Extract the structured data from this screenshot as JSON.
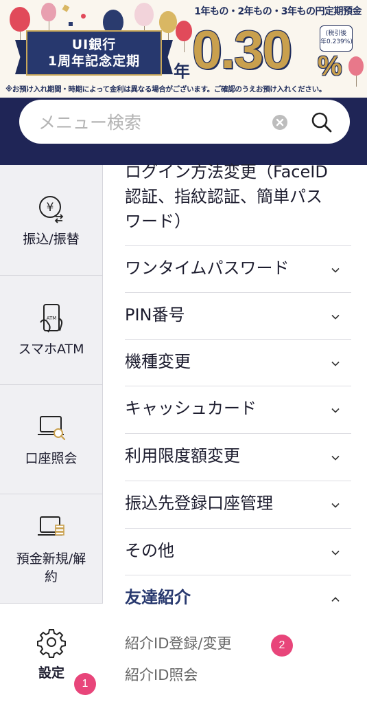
{
  "banner": {
    "top_text": "1年もの・2年もの・3年もの円定期預金",
    "ribbon_line1": "UI銀行",
    "ribbon_line2": "1周年記念定期",
    "nen": "年",
    "rate": "0.30",
    "percent": "%",
    "tax_line1": "(税引後",
    "tax_line2": "年0.239%)",
    "note": "※お預け入れ期間・時期によって金利は異なる場合がございます。ご確認のうえお預け入れください。"
  },
  "search": {
    "placeholder": "メニュー検索",
    "clear_icon": "clear-circle-icon",
    "search_icon": "magnifier-icon"
  },
  "sidebar": {
    "items": [
      {
        "label": "振込/振替",
        "icon": "yen-transfer-icon"
      },
      {
        "label": "スマホATM",
        "icon": "smartphone-atm-icon"
      },
      {
        "label": "口座照会",
        "icon": "account-inquiry-icon"
      },
      {
        "label": "預金新規/解約",
        "icon": "deposit-icon"
      },
      {
        "label": "設定",
        "icon": "gear-icon",
        "active": true
      }
    ]
  },
  "menu": {
    "partial_header": "ログイン方法変更（FaceID認証、指紋認証、簡単パスワード）",
    "rows": [
      {
        "label": "ワンタイムパスワード",
        "expanded": false
      },
      {
        "label": "PIN番号",
        "expanded": false
      },
      {
        "label": "機種変更",
        "expanded": false
      },
      {
        "label": "キャッシュカード",
        "expanded": false
      },
      {
        "label": "利用限度額変更",
        "expanded": false
      },
      {
        "label": "振込先登録口座管理",
        "expanded": false
      },
      {
        "label": "その他",
        "expanded": false
      },
      {
        "label": "友達紹介",
        "expanded": true
      }
    ],
    "subitems": [
      {
        "label": "紹介ID登録/変更"
      },
      {
        "label": "紹介ID照会"
      }
    ]
  },
  "badges": {
    "settings_badge": "1",
    "register_badge": "2"
  },
  "colors": {
    "navy": "#1f2556",
    "accent_navy": "#27386e",
    "gold": "#c9a04e",
    "badge_pink": "#e8457a",
    "sidebar_bg": "#f0f0f3"
  }
}
